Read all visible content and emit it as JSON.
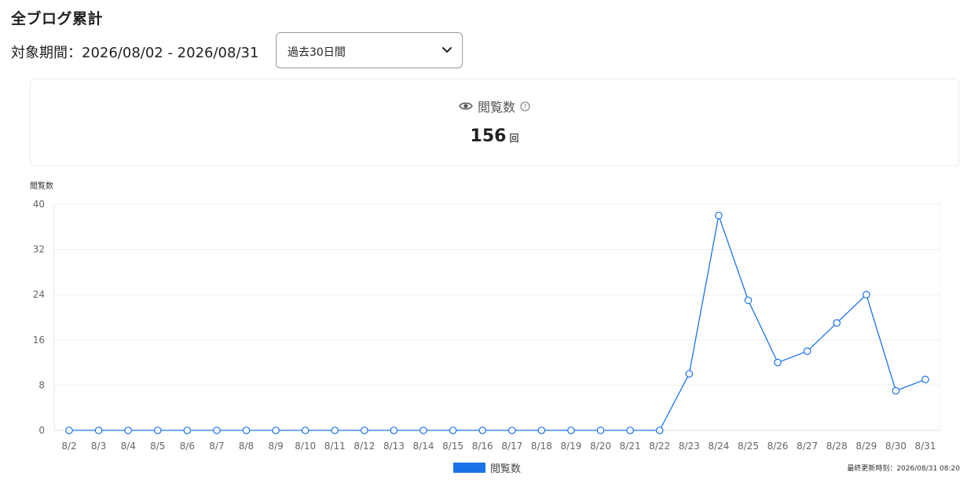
{
  "page": {
    "title": "全ブログ累計",
    "period_label": "対象期間：2026/08/02 - 2026/08/31"
  },
  "range_select": {
    "value": "過去30日間"
  },
  "metric": {
    "name": "閲覧数",
    "value": "156",
    "unit": "回",
    "icons": {
      "eye": "eye-icon",
      "help": "help-icon"
    }
  },
  "colors": {
    "series": "#1a73e8",
    "grid": "#eeeeee",
    "axis_text": "#666666"
  },
  "chart_data": {
    "type": "line",
    "ylabel": "閲覧数",
    "ylim": [
      0,
      40
    ],
    "yticks": [
      0,
      8,
      16,
      24,
      32,
      40
    ],
    "categories": [
      "8/2",
      "8/3",
      "8/4",
      "8/5",
      "8/6",
      "8/7",
      "8/8",
      "8/9",
      "8/10",
      "8/11",
      "8/12",
      "8/13",
      "8/14",
      "8/15",
      "8/16",
      "8/17",
      "8/18",
      "8/19",
      "8/20",
      "8/21",
      "8/22",
      "8/23",
      "8/24",
      "8/25",
      "8/26",
      "8/27",
      "8/28",
      "8/29",
      "8/30",
      "8/31"
    ],
    "series": [
      {
        "name": "閲覧数",
        "values": [
          0,
          0,
          0,
          0,
          0,
          0,
          0,
          0,
          0,
          0,
          0,
          0,
          0,
          0,
          0,
          0,
          0,
          0,
          0,
          0,
          0,
          10,
          38,
          23,
          12,
          14,
          19,
          24,
          7,
          9
        ]
      }
    ],
    "grid": true,
    "legend": "bottom-center"
  },
  "footer": {
    "updated": "最終更新時刻：2026/08/31 08:20"
  }
}
